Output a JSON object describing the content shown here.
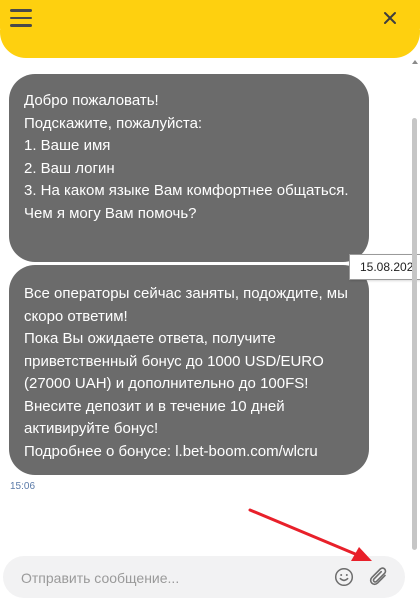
{
  "header": {
    "menu_icon": "hamburger-menu-icon",
    "close_icon": "close-icon",
    "accent_color": "#fed00f"
  },
  "messages": [
    {
      "text": "Добро пожаловать!\nПодскажите, пожалуйста:\n1. Ваше имя\n2. Ваш логин\n3. На каком языке Вам комфортнее общаться.\nЧем я могу Вам помочь?"
    },
    {
      "text": "Все операторы сейчас заняты, подождите, мы скоро ответим!\nПока Вы ожидаете ответа, получите приветственный бонус до 1000 USD/EURO (27000 UAH) и дополнительно до 100FS!\nВнесите депозит и в течение 10 дней активируйте бонус!\nПодробнее о бонусе: l.bet-boom.com/wlcru"
    }
  ],
  "message_time": "15:06",
  "tooltip_date": "15.08.202",
  "composer": {
    "placeholder": "Отправить сообщение...",
    "emoji_icon": "smiley-icon",
    "attach_icon": "paperclip-icon"
  },
  "annotation_arrow_color": "#e8202a"
}
